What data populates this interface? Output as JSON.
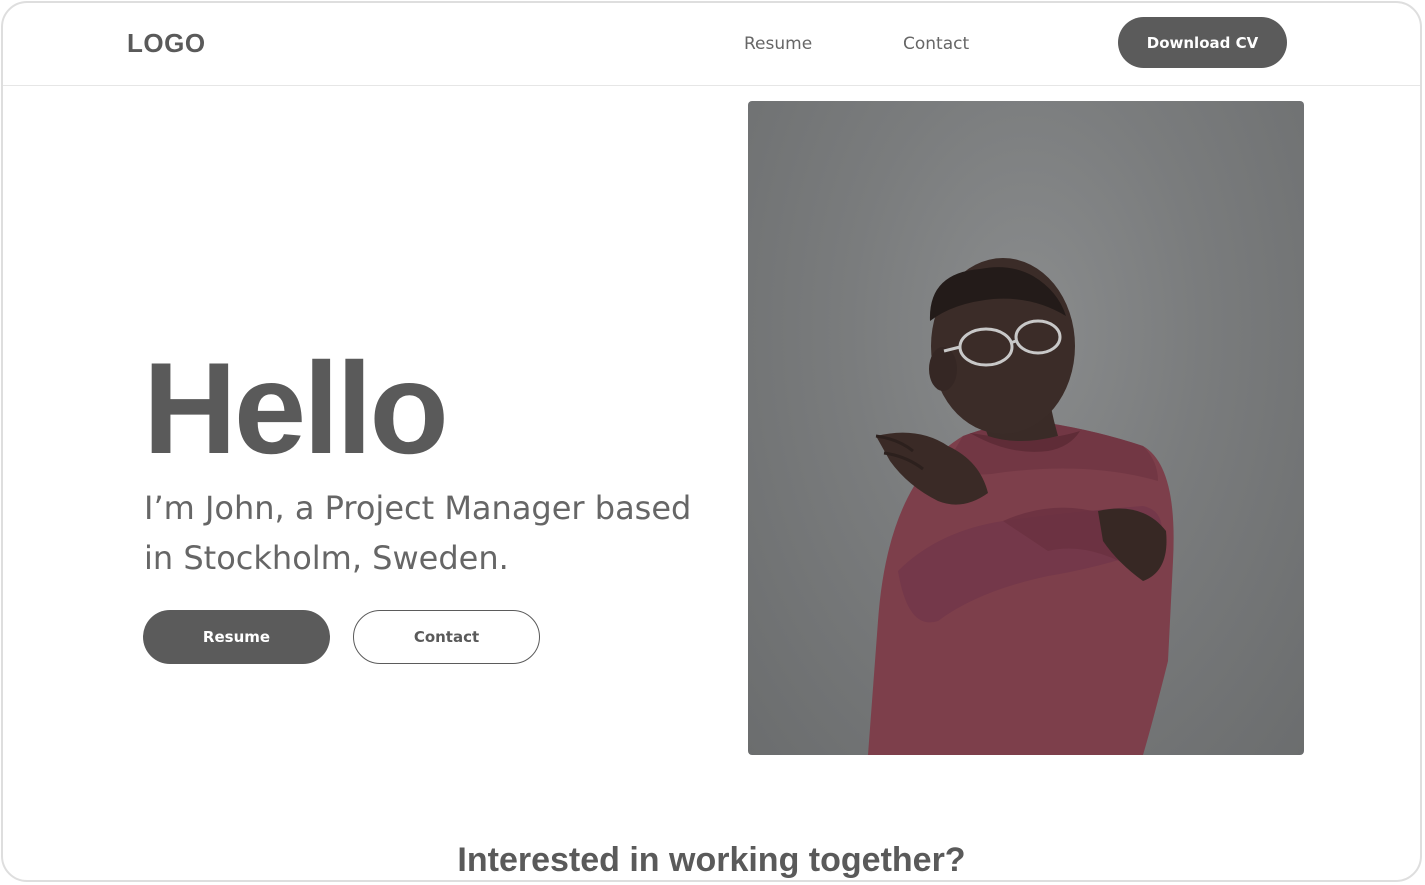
{
  "header": {
    "logo": "LOGO",
    "nav": {
      "resume": "Resume",
      "contact": "Contact"
    },
    "download_cv": "Download CV"
  },
  "hero": {
    "title": "Hello",
    "subtitle": "I’m John, a Project Manager based in Stockholm, Sweden.",
    "resume_button": "Resume",
    "contact_button": "Contact",
    "photo_icon": "portrait-photo"
  },
  "cta": {
    "title": "Interested in working together?"
  },
  "colors": {
    "primary": "#5b5b5b",
    "text": "#5a5a5a",
    "background": "#ffffff",
    "border": "#dedede"
  }
}
